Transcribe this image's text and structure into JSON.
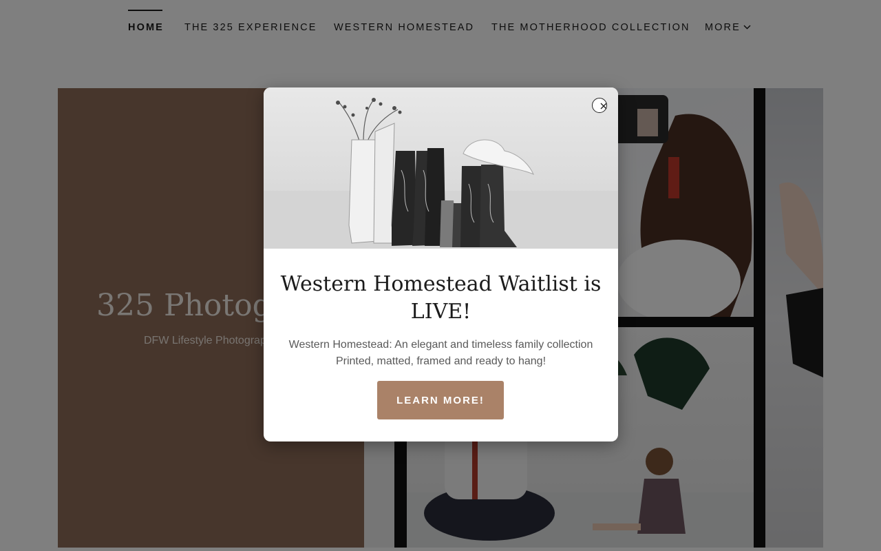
{
  "nav": {
    "items": [
      {
        "label": "HOME",
        "active": true
      },
      {
        "label": "THE 325 EXPERIENCE",
        "active": false
      },
      {
        "label": "WESTERN HOMESTEAD",
        "active": false
      },
      {
        "label": "THE MOTHERHOOD COLLECTION",
        "active": false
      },
      {
        "label": "MORE",
        "active": false,
        "icon": "chevron-down-icon"
      }
    ]
  },
  "hero": {
    "title": "325 Photogra",
    "subtitle": "DFW Lifestyle Photograp"
  },
  "modal": {
    "title": "Western Homestead Waitlist is LIVE!",
    "text_line1": "Western Homestead: An elegant and timeless family collection",
    "text_line2": "Printed, matted, framed and ready to hang!",
    "cta_label": "LEARN MORE!",
    "close_icon": "close-icon"
  },
  "colors": {
    "hero_brown": "#8f6c58",
    "cta_brown": "#aa8268",
    "overlay": "rgba(0,0,0,0.5)"
  }
}
